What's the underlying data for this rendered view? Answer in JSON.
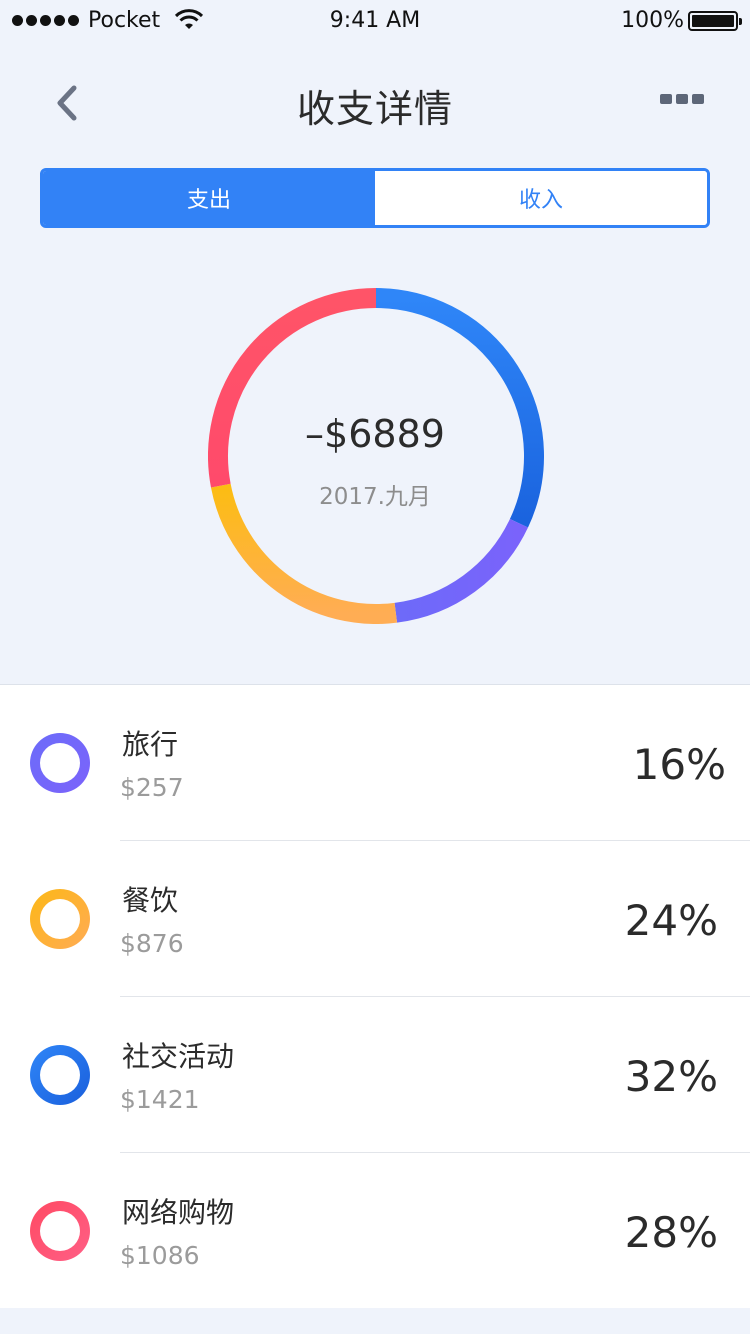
{
  "status_bar": {
    "carrier": "Pocket",
    "time": "9:41 AM",
    "battery": "100%"
  },
  "nav": {
    "title": "收支详情",
    "back_icon": "chevron-left-icon",
    "more_icon": "more-dots-icon"
  },
  "segment": {
    "tabs": [
      {
        "label": "支出",
        "active": true
      },
      {
        "label": "收入",
        "active": false
      }
    ]
  },
  "summary": {
    "total": "–$6889",
    "period": "2017.九月"
  },
  "colors": {
    "accent": "#3282f6",
    "travel": "#7266fb",
    "dining": "#fdb324",
    "social": "#2f7ff3",
    "shopping": "#ff4d69"
  },
  "chart_data": {
    "type": "pie",
    "categories": [
      "旅行",
      "餐饮",
      "社交活动",
      "网络购物"
    ],
    "values": [
      16,
      24,
      32,
      28
    ]
  },
  "list": {
    "items": [
      {
        "name": "旅行",
        "amount": "$257",
        "percent": "16%",
        "color_key": "travel"
      },
      {
        "name": "餐饮",
        "amount": "$876",
        "percent": "24%",
        "color_key": "dining"
      },
      {
        "name": "社交活动",
        "amount": "$1421",
        "percent": "32%",
        "color_key": "social"
      },
      {
        "name": "网络购物",
        "amount": "$1086",
        "percent": "28%",
        "color_key": "shopping"
      }
    ]
  }
}
